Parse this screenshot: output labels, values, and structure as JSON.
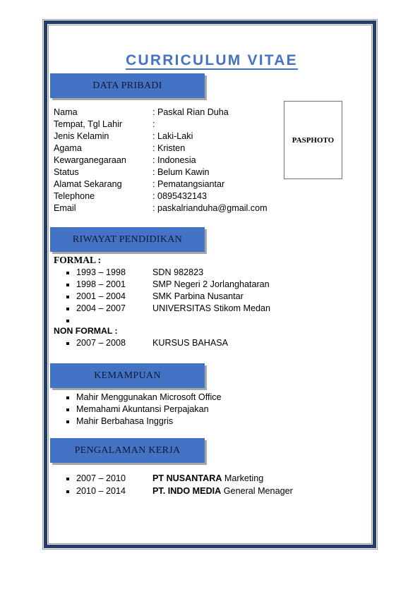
{
  "title": "CURRICULUM VITAE",
  "photo_placeholder": "PASPHOTO",
  "sections": {
    "personal": {
      "heading": "DATA PRIBADI",
      "fields": [
        {
          "label": "Nama",
          "value": ": Paskal Rian Duha"
        },
        {
          "label": "Tempat, Tgl Lahir",
          "value": ":"
        },
        {
          "label": "Jenis Kelamin",
          "value": ": Laki-Laki"
        },
        {
          "label": "Agama",
          "value": ": Kristen"
        },
        {
          "label": "Kewarganegaraan",
          "value": ": Indonesia"
        },
        {
          "label": "Status",
          "value": ": Belum Kawin"
        },
        {
          "label": "Alamat Sekarang",
          "value": ": Pematangsiantar"
        },
        {
          "label": "Telephone",
          "value": ": 0895432143"
        },
        {
          "label": "Email",
          "value": ": paskalrianduha@gmail.com"
        }
      ]
    },
    "education": {
      "heading": "RIWAYAT PENDIDIKAN",
      "formal_label": "FORMAL :",
      "formal": [
        {
          "years": "1993 – 1998",
          "institution": "SDN 982823"
        },
        {
          "years": "1998 – 2001",
          "institution": "SMP Negeri 2 Jorlanghataran"
        },
        {
          "years": "2001 – 2004",
          "institution": "SMK Parbina Nusantar"
        },
        {
          "years": "2004 – 2007",
          "institution": "UNIVERSITAS Stikom Medan"
        },
        {
          "years": "",
          "institution": ""
        }
      ],
      "nonformal_label": "NON FORMAL :",
      "nonformal": [
        {
          "years": "2007 – 2008",
          "institution": "KURSUS BAHASA"
        }
      ]
    },
    "skills": {
      "heading": "KEMAMPUAN",
      "items": [
        "Mahir Menggunakan Microsoft Office",
        "Memahami Akuntansi Perpajakan",
        "Mahir Berbahasa Inggris"
      ]
    },
    "experience": {
      "heading": "PENGALAMAN KERJA",
      "items": [
        {
          "years": "2007 – 2010",
          "company": "PT NUSANTARA",
          "role": " Marketing"
        },
        {
          "years": "2010 – 2014",
          "company": "PT. INDO MEDIA",
          "role": " General Menager"
        }
      ]
    }
  },
  "colors": {
    "accent": "#4472c4",
    "border": "#263d6b",
    "heading_text": "#111a33"
  }
}
